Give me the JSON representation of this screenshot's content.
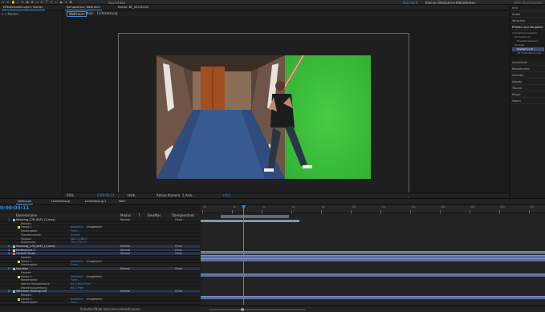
{
  "header": {
    "search_placeholder": "Hilfe durchsuchen",
    "workspaces": [
      "Standard",
      "Kleinen Bildschirm",
      "Bibliotheken"
    ],
    "extra_label": "Ausrichten"
  },
  "project_panel": {
    "tab_label": "Effekteinstellungen: Marker",
    "subtitle": "n • Marker"
  },
  "composition_panel": {
    "tabs": [
      "Komposition: Weltraum",
      "Ebene: BF_0372D.DV"
    ],
    "sub_tabs": [
      "Weltraum",
      "Main",
      "Lichtsetzung"
    ],
    "zoom": "50%",
    "timecode": "0:00:03:11",
    "resolution": "Halb",
    "camera": "Aktive Kamera",
    "view": "1 Ansi...",
    "exposure": "+0,0"
  },
  "right_panel": {
    "items": [
      "Info",
      "Audio",
      "Vorschau",
      "Effekte und Vorgaben",
      "Ausrichten",
      "Bibliotheken",
      "Zeichen",
      "Absatz",
      "Tracker",
      "Pinsel",
      "Malen"
    ],
    "effects_tree": [
      "Animationsvorgaben",
      "Hintergründe",
      "Transitionsgrenze",
      "Keylight",
      "Keylight (1.2)",
      "3D Tiefensteuerung"
    ]
  },
  "timeline": {
    "tabs": [
      "Weltraum",
      "Lichtsetzung",
      "Lichtsetzung 2",
      "Main"
    ],
    "timecode": "0:00:03:11",
    "columns": [
      "Ebenenname",
      "Modus",
      "T",
      "BewMas",
      "Übergeordnet"
    ],
    "ruler_labels": [
      "0s",
      "2s",
      "4s",
      "6s",
      "8s",
      "10s",
      "12s",
      "14s",
      "16s",
      "18s",
      "20s",
      "22s"
    ],
    "rows": [
      {
        "num": "1",
        "name": "Shooting_178_0047_C(.mov)",
        "mode": "Normal",
        "parent": "Ohne",
        "color": "#8cc1e6",
        "sel": false
      },
      {
        "num": "",
        "name": "Masken",
        "mode": "",
        "parent": "",
        "color": "",
        "sel": false
      },
      {
        "num": "",
        "name": "Maske 1",
        "mode": "Addieren",
        "parent": "Umgekehrt",
        "color": "#dfd76b",
        "sel": false
      },
      {
        "num": "",
        "name": "Maskenpfad",
        "mode": "Form...",
        "parent": "",
        "color": "",
        "sel": false
      },
      {
        "num": "",
        "name": "Transformieren",
        "mode": "Zurück",
        "parent": "",
        "color": "",
        "sel": false
      },
      {
        "num": "",
        "name": "Position",
        "mode": "380,0,288,0",
        "parent": "",
        "color": "",
        "sel": false
      },
      {
        "num": "",
        "name": "Skalierung",
        "mode": "79,9,79,9 %",
        "parent": "",
        "color": "",
        "sel": false
      },
      {
        "num": "2",
        "name": "Shooting_178_0047_C(.mov)",
        "mode": "Normal",
        "parent": "Ohne",
        "color": "#8cc1e6",
        "sel": true
      },
      {
        "num": "3",
        "name": "Hintergrund 2",
        "mode": "Normal",
        "parent": "Ohne",
        "color": "#dfd76b",
        "sel": true
      },
      {
        "num": "4",
        "name": "Camera Raum",
        "mode": "Normal",
        "parent": "Ohne",
        "color": "#e07070",
        "sel": true
      },
      {
        "num": "",
        "name": "Masken",
        "mode": "",
        "parent": "",
        "color": "",
        "sel": false
      },
      {
        "num": "",
        "name": "Maske 1",
        "mode": "Addieren",
        "parent": "Umgekehrt",
        "color": "#dfd76b",
        "sel": false
      },
      {
        "num": "",
        "name": "Maskenpfad",
        "mode": "Form...",
        "parent": "",
        "color": "",
        "sel": false
      },
      {
        "num": "5",
        "name": "Hypnose",
        "mode": "Normal",
        "parent": "Ohne",
        "color": "#8cc1e6",
        "sel": true
      },
      {
        "num": "",
        "name": "Masken",
        "mode": "",
        "parent": "",
        "color": "",
        "sel": false
      },
      {
        "num": "",
        "name": "Maske 1",
        "mode": "Addieren",
        "parent": "Umgekehrt",
        "color": "#dfd76b",
        "sel": false
      },
      {
        "num": "",
        "name": "Maskenpfad",
        "mode": "Form...",
        "parent": "",
        "color": "",
        "sel": false
      },
      {
        "num": "",
        "name": "Weiche Maskenkante",
        "mode": "65,0,65,0 Pixel",
        "parent": "",
        "color": "",
        "sel": false
      },
      {
        "num": "",
        "name": "Maskenausweitung",
        "mode": "60,0 Pixel",
        "parent": "",
        "color": "",
        "sel": false
      },
      {
        "num": "6",
        "name": "Weltraum Hintergrund",
        "mode": "Normal",
        "parent": "Ohne",
        "color": "#8cc1e6",
        "sel": true
      },
      {
        "num": "",
        "name": "Masken",
        "mode": "",
        "parent": "",
        "color": "",
        "sel": false
      },
      {
        "num": "",
        "name": "Maske 1",
        "mode": "Addieren",
        "parent": "Umgekehrt",
        "color": "#dfd76b",
        "sel": false
      },
      {
        "num": "",
        "name": "Maskenpfad",
        "mode": "Form...",
        "parent": "",
        "color": "",
        "sel": false
      }
    ],
    "footer_label": "Schalter/Modi aktivieren/deaktivieren"
  }
}
